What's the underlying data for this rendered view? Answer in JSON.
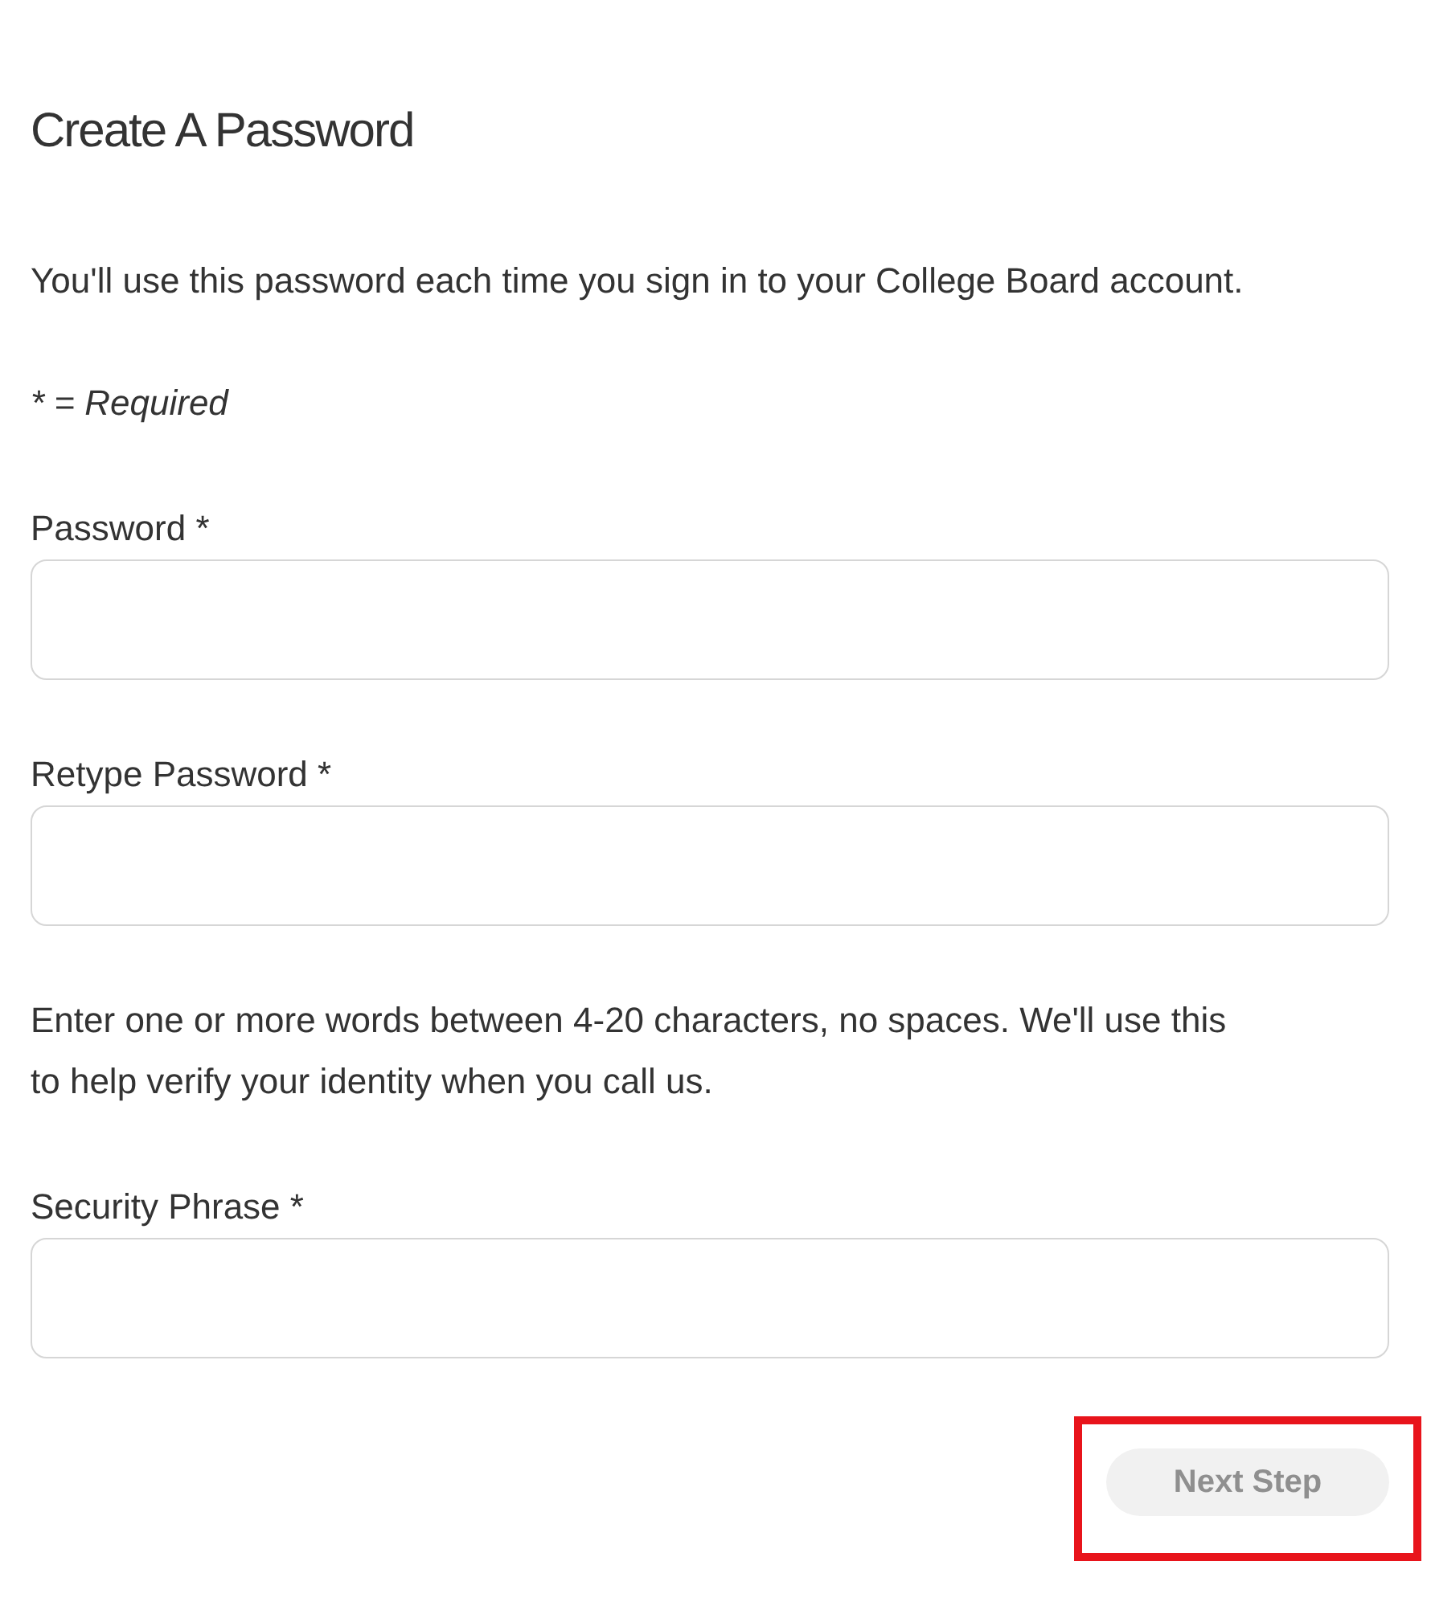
{
  "title": "Create A Password",
  "intro": "You'll use this password each time you sign in to your College Board account.",
  "required_note": "* = Required",
  "fields": [
    {
      "kind": "password",
      "label": "Password *"
    },
    {
      "kind": "password",
      "label": "Retype Password *"
    },
    {
      "kind": "hint",
      "text": "Enter one or more words between 4-20 characters, no spaces. We'll use this to help verify your identity when you call us."
    },
    {
      "kind": "text",
      "label": "Security Phrase *"
    }
  ],
  "next_button": {
    "label": "Next Step",
    "disabled": true,
    "highlighted": true
  }
}
